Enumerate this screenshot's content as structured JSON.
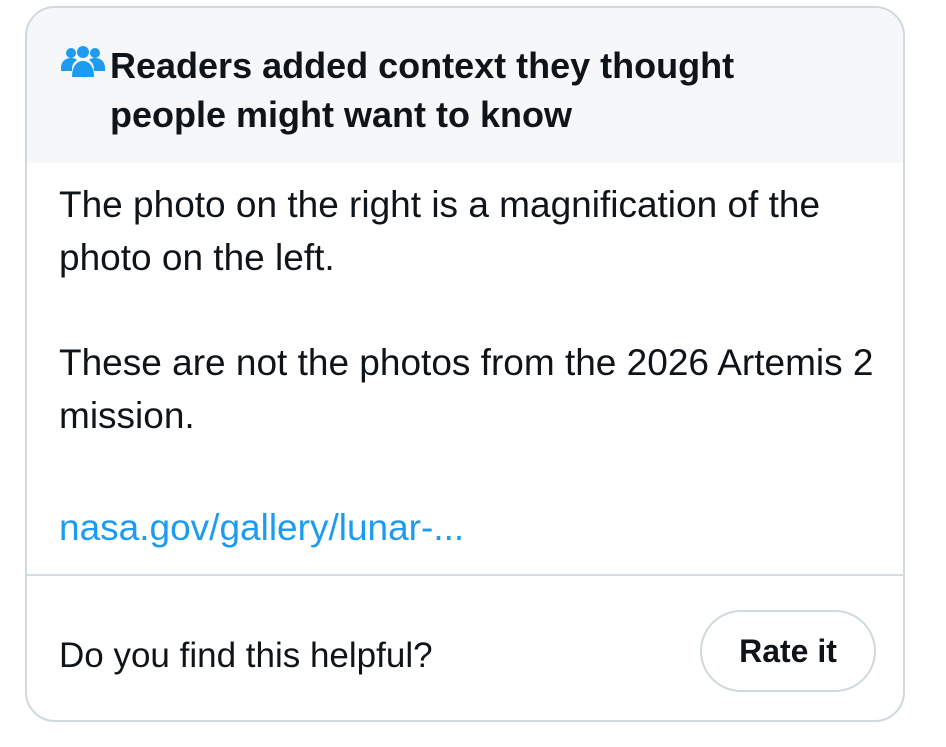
{
  "note": {
    "header": {
      "icon": "people-group-icon",
      "title": "Readers added context they thought people might want to know"
    },
    "paragraphs": [
      "The photo on the right is a magnification of the photo on the left.",
      "These are not the photos from the 2026 Artemis 2 mission."
    ],
    "link_text": "nasa.gov/gallery/lunar-..."
  },
  "footer": {
    "question": "Do you find this helpful?",
    "rate_label": "Rate it"
  },
  "colors": {
    "header_bg": "#f5f7f8",
    "icon": "#1d9bf0",
    "link": "#1d9bf0",
    "text": "#0f1419",
    "border": "#cfd9de"
  }
}
